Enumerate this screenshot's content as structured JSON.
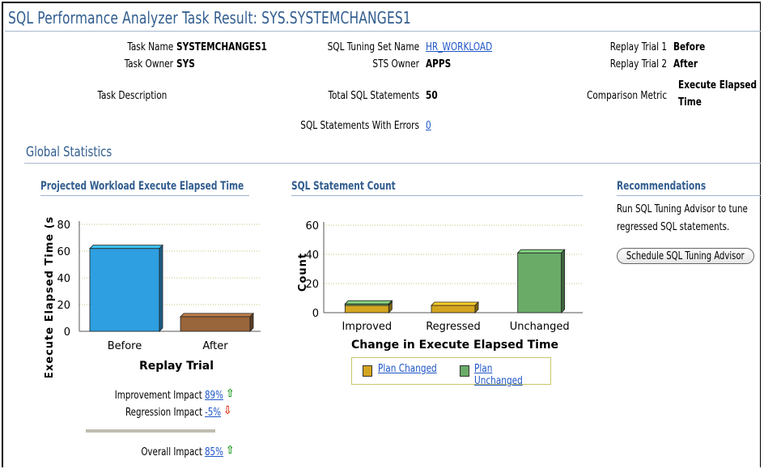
{
  "header": {
    "title": "SQL Performance Analyzer Task Result: SYS.SYSTEMCHANGES1"
  },
  "task": {
    "name_label": "Task Name",
    "name": "SYSTEMCHANGES1",
    "owner_label": "Task Owner",
    "owner": "SYS",
    "description_label": "Task Description",
    "sts_name_label": "SQL Tuning Set Name",
    "sts_name": "HR_WORKLOAD",
    "sts_owner_label": "STS Owner",
    "sts_owner": "APPS",
    "total_label": "Total SQL Statements",
    "total": "50",
    "errors_label": "SQL Statements With Errors",
    "errors": "0",
    "trial1_label": "Replay Trial 1",
    "trial1": "Before",
    "trial2_label": "Replay Trial 2",
    "trial2": "After",
    "metric_label": "Comparison Metric",
    "metric_line1": "Execute Elapsed",
    "metric_line2": "Time"
  },
  "global_stats": {
    "title": "Global Statistics"
  },
  "projected_chart": {
    "title": "Projected Workload Execute Elapsed Time",
    "ylabel": "Execute Elapsed Time (s",
    "xlabel": "Replay Trial",
    "ticks": [
      "0",
      "20",
      "40",
      "60",
      "80"
    ],
    "labels": [
      "Before",
      "After"
    ]
  },
  "count_chart": {
    "title": "SQL Statement Count",
    "ylabel": "Count",
    "xlabel": "Change in Execute Elapsed Time",
    "ticks": [
      "0",
      "20",
      "40",
      "60"
    ],
    "labels": [
      "Improved",
      "Regressed",
      "Unchanged"
    ],
    "legend": {
      "plan_changed": "Plan Changed",
      "plan_unchanged": "Plan Unchanged"
    }
  },
  "chart_data": [
    {
      "type": "bar",
      "title": "Projected Workload Execute Elapsed Time",
      "categories": [
        "Before",
        "After"
      ],
      "values": [
        62,
        11
      ],
      "colors": [
        "#2e9fe0",
        "#99653a"
      ],
      "xlabel": "Replay Trial",
      "ylabel": "Execute Elapsed Time (s",
      "ylim": [
        0,
        80
      ],
      "grid": true
    },
    {
      "type": "bar",
      "title": "SQL Statement Count",
      "categories": [
        "Improved",
        "Regressed",
        "Unchanged"
      ],
      "series": [
        {
          "name": "Plan Changed",
          "values": [
            5,
            5,
            0
          ],
          "color": "#d4a520"
        },
        {
          "name": "Plan Unchanged",
          "values": [
            1,
            0,
            41
          ],
          "color": "#6aab68"
        }
      ],
      "xlabel": "Change in Execute Elapsed Time",
      "ylabel": "Count",
      "ylim": [
        0,
        60
      ],
      "grid": true,
      "stacked": true,
      "legend": "bottom"
    }
  ],
  "recommendations": {
    "title": "Recommendations",
    "text_line1": "Run SQL Tuning Advisor to tune",
    "text_line2": "regressed SQL statements.",
    "button": "Schedule SQL Tuning Advisor"
  },
  "impact": {
    "improvement_label": "Improvement Impact",
    "improvement": "89%",
    "regression_label": "Regression Impact",
    "regression": "-5%",
    "overall_label": "Overall Impact",
    "overall": "85%"
  }
}
